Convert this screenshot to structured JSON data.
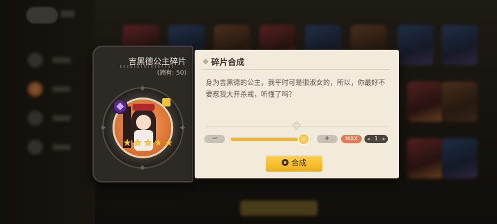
{
  "fragment": {
    "name": "吉黑德公主碎片",
    "owned": "(拥有: 50)",
    "stars": 5
  },
  "craft": {
    "title": "碎片合成",
    "description": "身为吉黑德的公主，我平时可是很淑女的，所以，你最好不要惹我大开杀戒，听懂了吗？",
    "minus_label": "−",
    "plus_label": "+",
    "max_label": "MAX",
    "count": "1",
    "slider_level": 0.9,
    "button_label": "合成"
  },
  "colors": {
    "accent": "#f2b42a",
    "max_button": "#e47a57",
    "panel_bg": "#f2ebdb"
  }
}
